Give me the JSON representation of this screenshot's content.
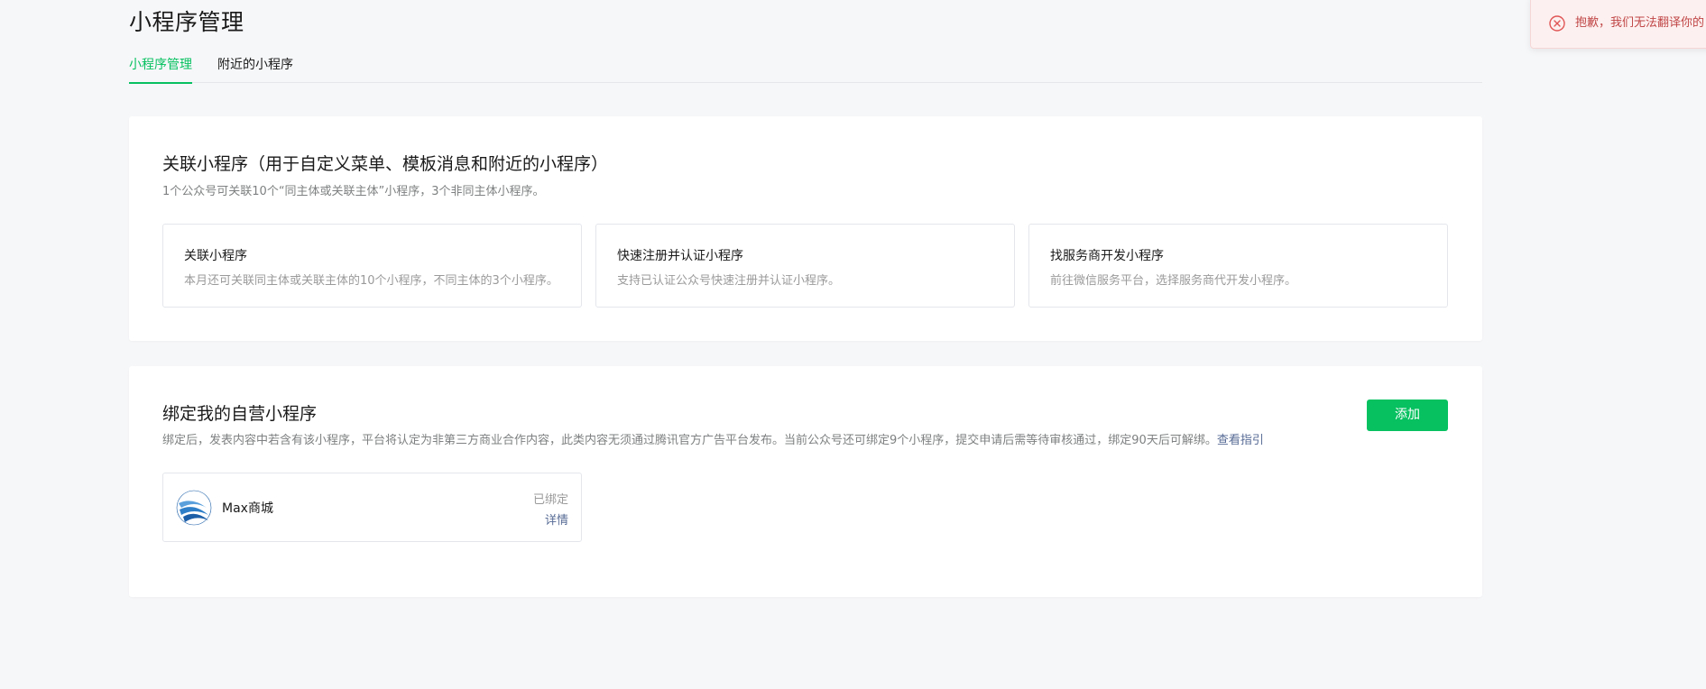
{
  "page": {
    "title": "小程序管理"
  },
  "tabs": [
    {
      "label": "小程序管理",
      "active": true
    },
    {
      "label": "附近的小程序",
      "active": false
    }
  ],
  "link_section": {
    "title": "关联小程序（用于自定义菜单、模板消息和附近的小程序）",
    "description": "1个公众号可关联10个“同主体或关联主体”小程序，3个非同主体小程序。",
    "options": [
      {
        "title": "关联小程序",
        "description": "本月还可关联同主体或关联主体的10个小程序，不同主体的3个小程序。"
      },
      {
        "title": "快速注册并认证小程序",
        "description": "支持已认证公众号快速注册并认证小程序。"
      },
      {
        "title": "找服务商开发小程序",
        "description": "前往微信服务平台，选择服务商代开发小程序。"
      }
    ]
  },
  "bind_section": {
    "title": "绑定我的自营小程序",
    "description": "绑定后，发表内容中若含有该小程序，平台将认定为非第三方商业合作内容，此类内容无须通过腾讯官方广告平台发布。当前公众号还可绑定9个小程序，提交申请后需等待审核通过，绑定90天后可解绑。",
    "guide_link": "查看指引",
    "add_button": "添加",
    "apps": [
      {
        "name": "Max商城",
        "status": "已绑定",
        "detail_link": "详情",
        "logo_icon": "max-mall-logo"
      }
    ]
  },
  "toast": {
    "text": "抱歉，我们无法翻译你的",
    "icon": "error-circle-icon",
    "color": "#e05555"
  },
  "colors": {
    "accent": "#07c160",
    "link": "#576b95",
    "background": "#f6f7f9"
  }
}
